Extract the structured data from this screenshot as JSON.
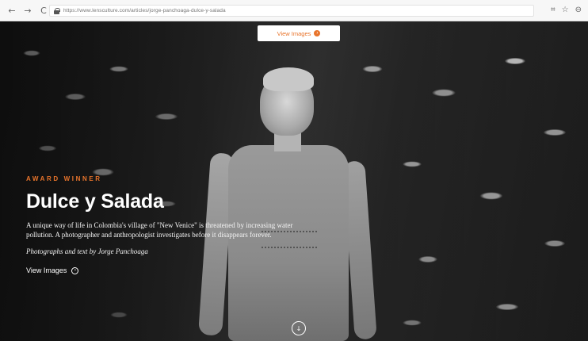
{
  "browser": {
    "back_icon": "←",
    "forward_icon": "→",
    "reload_icon": "C",
    "url": "https://www.lensculture.com/articles/jorge-panchoaga-dulce-y-salada",
    "translate_icon": "⌗",
    "star_icon": "☆",
    "account_icon": "⊖"
  },
  "hero": {
    "top_cta": {
      "label": "View Images",
      "icon": "›"
    },
    "badge": "AWARD WINNER",
    "title": "Dulce y Salada",
    "description": "A unique way of life in Colombia's village of \"New Venice\" is threatened by increasing water pollution. A photographer and anthropologist investigates before it disappears forever.",
    "byline": "Photographs and text by Jorge Panchoaga",
    "view_link": {
      "label": "View Images",
      "icon": "›"
    },
    "scroll_icon": "↓"
  },
  "colors": {
    "accent": "#e8742b",
    "chrome_bg": "#f7f7f7",
    "text_on_hero": "#ffffff"
  }
}
